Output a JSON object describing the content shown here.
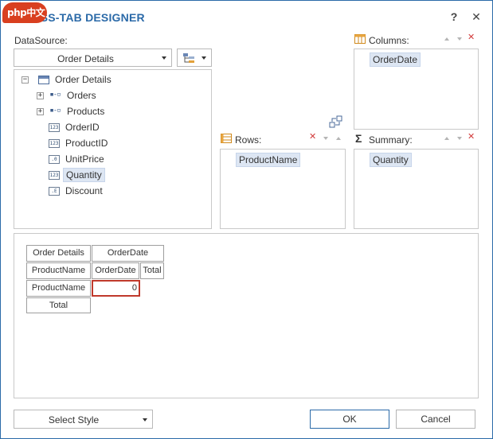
{
  "window": {
    "title": "CROSS-TAB DESIGNER",
    "logo_text": "php中文网",
    "help_label": "?",
    "close_label": "✕"
  },
  "datasource": {
    "label": "DataSource:",
    "selected": "Order Details",
    "tree": [
      {
        "label": "Order Details",
        "icon": "table-icon",
        "expander": "−"
      },
      {
        "label": "Orders",
        "icon": "relation-icon",
        "expander": "+"
      },
      {
        "label": "Products",
        "icon": "relation-icon",
        "expander": "+"
      },
      {
        "label": "OrderID",
        "icon": "numeric-field-icon",
        "glyph": "123"
      },
      {
        "label": "ProductID",
        "icon": "numeric-field-icon",
        "glyph": "123"
      },
      {
        "label": "UnitPrice",
        "icon": "decimal-field-icon",
        "glyph": ".0"
      },
      {
        "label": "Quantity",
        "icon": "numeric-field-icon",
        "glyph": "123",
        "selected": true
      },
      {
        "label": "Discount",
        "icon": "float-field-icon",
        "glyph": ".E"
      }
    ]
  },
  "columns": {
    "label": "Columns:",
    "items": [
      "OrderDate"
    ]
  },
  "rows": {
    "label": "Rows:",
    "items": [
      "ProductName"
    ]
  },
  "summary": {
    "label": "Summary:",
    "items": [
      "Quantity"
    ],
    "symbol": "Σ"
  },
  "preview": {
    "corner": "Order Details",
    "col_header": "OrderDate",
    "row_header": "ProductName",
    "sub_col": "OrderDate",
    "total_col": "Total",
    "row_value": "ProductName",
    "cell_value": "0",
    "total_row": "Total"
  },
  "footer": {
    "style_label": "Select Style",
    "ok_label": "OK",
    "cancel_label": "Cancel"
  },
  "colors": {
    "accent": "#2b6aa8",
    "selection": "#dde6f3",
    "delete": "#d23b3b",
    "active_cell": "#c0392b"
  }
}
